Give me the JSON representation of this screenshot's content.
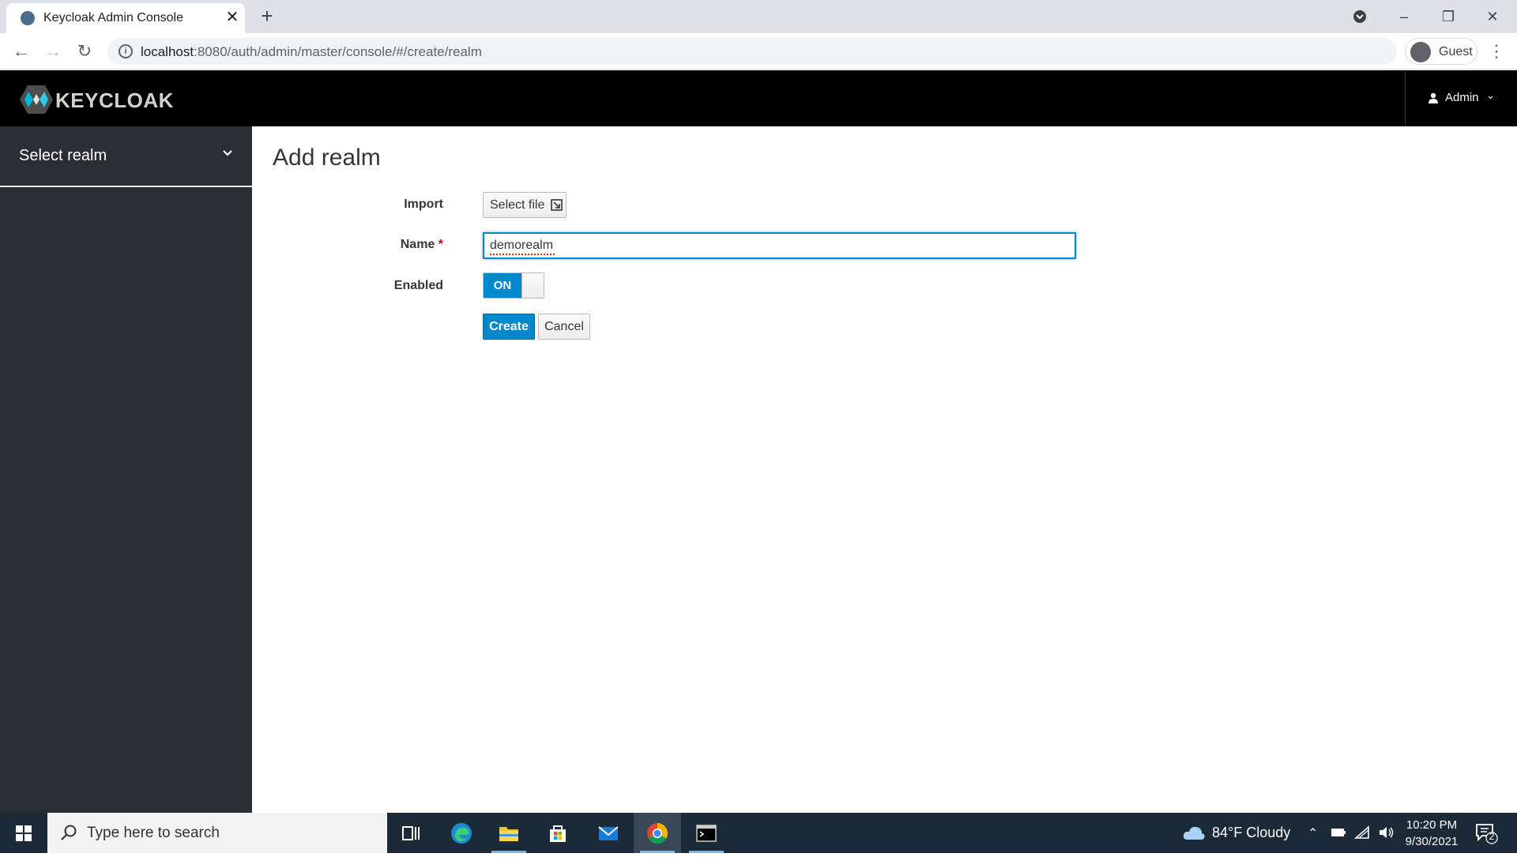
{
  "browser": {
    "tab_title": "Keycloak Admin Console",
    "tab_close": "✕",
    "new_tab": "+",
    "url_host": "localhost",
    "url_path": ":8080/auth/admin/master/console/#/create/realm",
    "profile_name": "Guest"
  },
  "header": {
    "logo_text": "KEYCLOAK",
    "user_name": "Admin"
  },
  "sidebar": {
    "realm_select_label": "Select realm"
  },
  "main": {
    "page_title": "Add realm",
    "form": {
      "import_label": "Import",
      "select_file_label": "Select file",
      "name_label": "Name",
      "name_required_mark": "*",
      "name_value": "demorealm",
      "enabled_label": "Enabled",
      "enabled_toggle": "ON",
      "create_label": "Create",
      "cancel_label": "Cancel"
    }
  },
  "taskbar": {
    "search_placeholder": "Type here to search",
    "weather": "84°F  Cloudy",
    "time": "10:20 PM",
    "date": "9/30/2021",
    "notification_count": "2"
  },
  "colors": {
    "accent": "#0088ce",
    "sidebar_bg": "#292e34",
    "header_bg": "#000000",
    "taskbar_bg": "#1c2a38"
  }
}
